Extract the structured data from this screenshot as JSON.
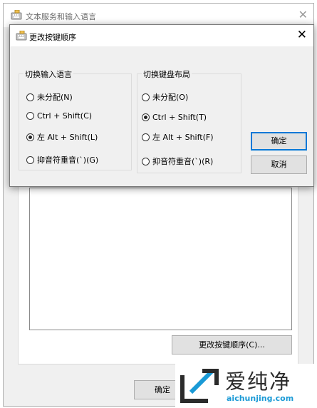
{
  "background_window": {
    "title": "文本服务和输入语言",
    "change_keys_button": "更改按键顺序(C)...",
    "ok_button": "确定"
  },
  "dialog": {
    "title": "更改按键顺序",
    "input_language_group": {
      "label": "切换输入语言",
      "options": [
        {
          "label": "未分配(N)",
          "checked": false
        },
        {
          "label": "Ctrl + Shift(C)",
          "checked": false
        },
        {
          "label": "左 Alt + Shift(L)",
          "checked": true
        },
        {
          "label": "抑音符重音(`)(G)",
          "checked": false
        }
      ]
    },
    "keyboard_layout_group": {
      "label": "切换键盘布局",
      "options": [
        {
          "label": "未分配(O)",
          "checked": false
        },
        {
          "label": "Ctrl + Shift(T)",
          "checked": true
        },
        {
          "label": "左 Alt + Shift(F)",
          "checked": false
        },
        {
          "label": "抑音符重音(`)(R)",
          "checked": false
        }
      ]
    },
    "ok_button": "确定",
    "cancel_button": "取消"
  },
  "watermark": {
    "brand": "爱纯净",
    "url": "aichunjing.com"
  }
}
